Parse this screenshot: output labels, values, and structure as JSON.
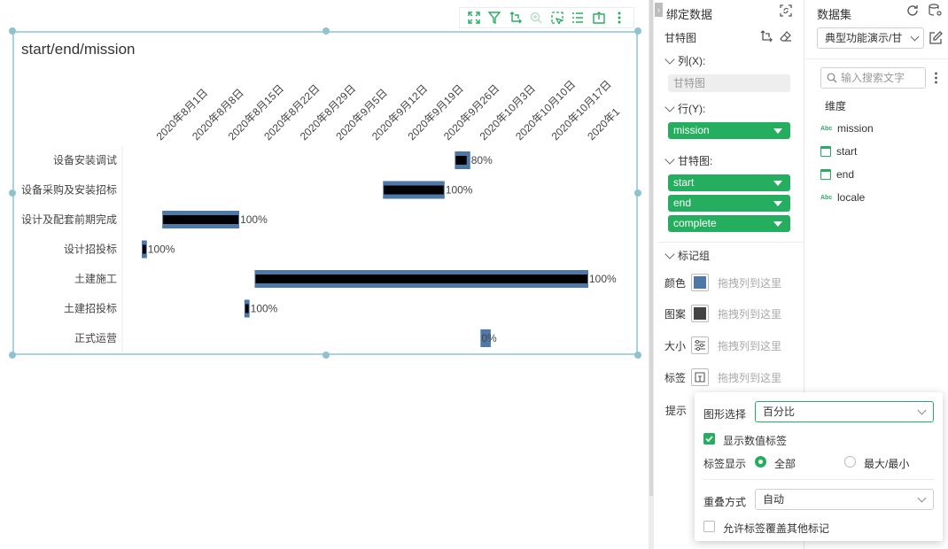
{
  "chart": {
    "title": "start/end/mission",
    "toolbar_icons": [
      "expand-icon",
      "filter-icon",
      "swap-axis-icon",
      "zoom-icon",
      "select-icon",
      "list-icon",
      "export-icon",
      "more-icon"
    ]
  },
  "chart_data": {
    "type": "gantt",
    "title": "start/end/mission",
    "x_ticks": [
      "2020年8月1日",
      "2020年8月8日",
      "2020年8月15日",
      "2020年8月22日",
      "2020年8月29日",
      "2020年9月5日",
      "2020年9月12日",
      "2020年9月19日",
      "2020年9月26日",
      "2020年10月3日",
      "2020年10月10日",
      "2020年10月17日",
      "2020年1"
    ],
    "xlim": [
      "2020-07-29",
      "2020-10-24"
    ],
    "tasks": [
      {
        "mission": "设备安装调试",
        "start": "2020-09-28",
        "end": "2020-10-01",
        "complete": 0.8,
        "label": "80%"
      },
      {
        "mission": "设备采购及安装招标",
        "start": "2020-09-14",
        "end": "2020-09-26",
        "complete": 1.0,
        "label": "100%"
      },
      {
        "mission": "设计及配套前期完成",
        "start": "2020-08-02",
        "end": "2020-08-17",
        "complete": 1.0,
        "label": "100%"
      },
      {
        "mission": "设计招投标",
        "start": "2020-07-29",
        "end": "2020-07-30",
        "complete": 1.0,
        "label": "100%"
      },
      {
        "mission": "土建施工",
        "start": "2020-08-20",
        "end": "2020-10-24",
        "complete": 1.0,
        "label": "100%"
      },
      {
        "mission": "土建招投标",
        "start": "2020-08-18",
        "end": "2020-08-19",
        "complete": 1.0,
        "label": "100%"
      },
      {
        "mission": "正式运营",
        "start": "2020-10-03",
        "end": "2020-10-05",
        "complete": 0.0,
        "label": "0%"
      }
    ],
    "colors": {
      "bar": "#4e79a7",
      "progress": "#000000"
    }
  },
  "bind": {
    "header": "绑定数据",
    "chart_type": "甘特图",
    "col_label": "列(X):",
    "col_field": "甘特图",
    "row_label": "行(Y):",
    "row_pill": "mission",
    "gantt_label": "甘特图:",
    "gantt_pills": [
      "start",
      "end",
      "complete"
    ],
    "marks_label": "标记组",
    "mark_rows": [
      {
        "label": "颜色",
        "drop": "拖拽列到这里",
        "icon": "color-swatch-icon"
      },
      {
        "label": "图案",
        "drop": "拖拽列到这里",
        "icon": "pattern-swatch-icon"
      },
      {
        "label": "大小",
        "drop": "拖拽列到这里",
        "icon": "size-icon"
      },
      {
        "label": "标签",
        "drop": "拖拽列到这里",
        "icon": "label-icon"
      }
    ],
    "tooltip_label": "提示",
    "accent": "#26ae60"
  },
  "dataset": {
    "header": "数据集",
    "selected": "典型功能演示/甘",
    "search_placeholder": "输入搜索文字",
    "dim_header": "维度",
    "fields": [
      {
        "name": "mission",
        "type": "text"
      },
      {
        "name": "start",
        "type": "date"
      },
      {
        "name": "end",
        "type": "date"
      },
      {
        "name": "locale",
        "type": "text"
      }
    ]
  },
  "popup": {
    "shape_label": "图形选择",
    "shape_value": "百分比",
    "show_value_label": "显示数值标签",
    "show_value_checked": true,
    "label_display": "标签显示",
    "radio_all": "全部",
    "radio_maxmin": "最大/最小",
    "selected_radio": "全部",
    "overlap_label": "重叠方式",
    "overlap_value": "自动",
    "allow_overlap": "允许标签覆盖其他标记",
    "allow_overlap_checked": false
  }
}
